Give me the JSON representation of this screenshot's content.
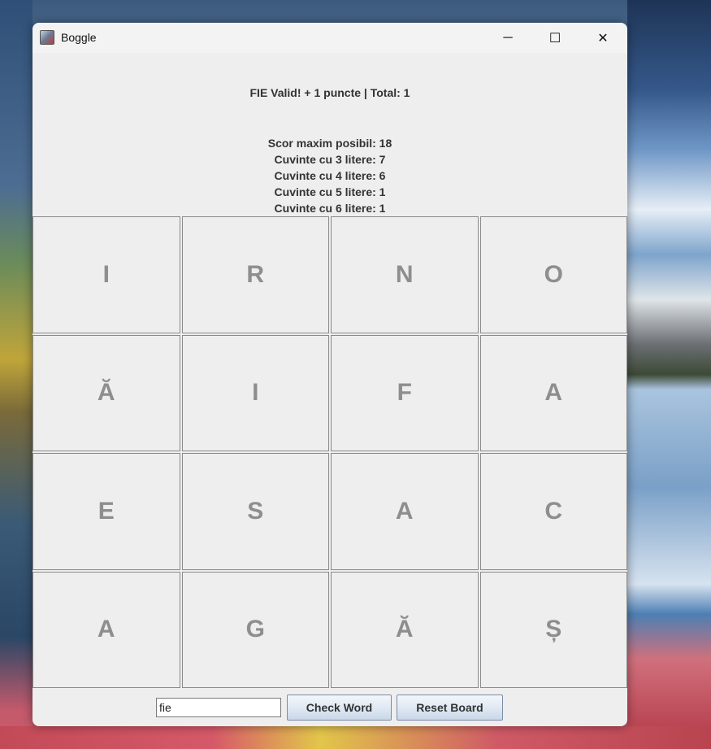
{
  "window": {
    "title": "Boggle",
    "minimize_glyph": "─",
    "maximize_glyph": "☐",
    "close_glyph": "✕"
  },
  "status_message": "FIE Valid! + 1 puncte | Total: 1",
  "stats": {
    "max_score": "Scor maxim posibil: 18",
    "words_3": "Cuvinte cu 3 litere: 7",
    "words_4": "Cuvinte cu 4 litere: 6",
    "words_5": "Cuvinte cu 5 litere: 1",
    "words_6": "Cuvinte cu 6 litere: 1"
  },
  "board": [
    [
      "I",
      "R",
      "N",
      "O"
    ],
    [
      "Ă",
      "I",
      "F",
      "A"
    ],
    [
      "E",
      "S",
      "A",
      "C"
    ],
    [
      "A",
      "G",
      "Ă",
      "Ș"
    ]
  ],
  "input": {
    "value": "fie"
  },
  "buttons": {
    "check": "Check Word",
    "reset": "Reset Board"
  },
  "colors": {
    "window_bg": "#eeeeee",
    "letter_color": "#8e8e8e",
    "text_color": "#333333"
  }
}
